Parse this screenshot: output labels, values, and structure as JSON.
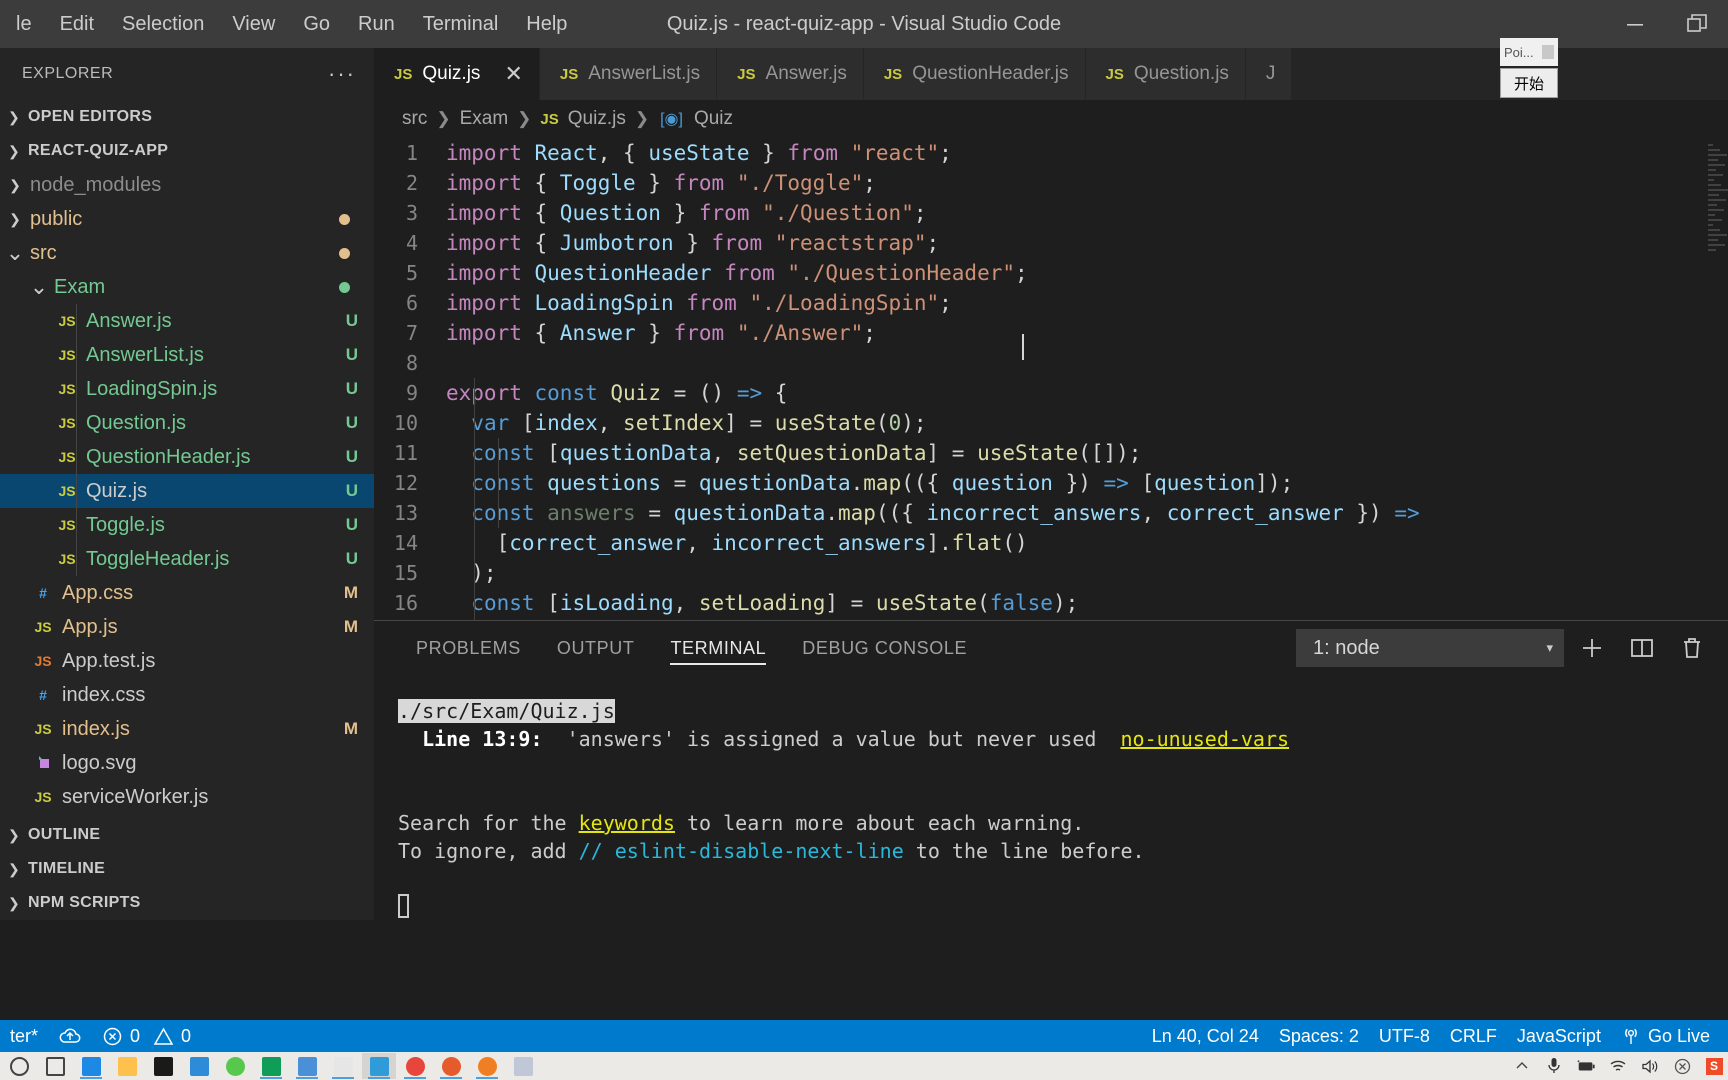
{
  "titlebar": {
    "menu": [
      "le",
      "Edit",
      "Selection",
      "View",
      "Go",
      "Run",
      "Terminal",
      "Help"
    ],
    "window_title": "Quiz.js - react-quiz-app - Visual Studio Code",
    "minimize_label": "minimize",
    "restore_label": "restore"
  },
  "popup": {
    "top_label": "Poi...",
    "bottom_label": "开始"
  },
  "sidebar": {
    "title": "EXPLORER",
    "more_actions": "···",
    "sections": [
      {
        "label": "OPEN EDITORS",
        "expanded": false
      },
      {
        "label": "REACT-QUIZ-APP",
        "expanded": true
      }
    ],
    "tree": [
      {
        "name": "node_modules",
        "type": "folder",
        "expanded": false,
        "indent": 1,
        "color": "dim",
        "git": "",
        "dot": ""
      },
      {
        "name": "public",
        "type": "folder",
        "expanded": false,
        "indent": 1,
        "color": "modified",
        "git": "",
        "dot": "#e2c08d"
      },
      {
        "name": "src",
        "type": "folder",
        "expanded": true,
        "indent": 1,
        "color": "modified",
        "git": "",
        "dot": "#e2c08d"
      },
      {
        "name": "Exam",
        "type": "folder",
        "expanded": true,
        "indent": 2,
        "color": "untracked",
        "git": "",
        "dot": "#73c991"
      },
      {
        "name": "Answer.js",
        "type": "js",
        "indent": 3,
        "color": "untracked",
        "git": "U"
      },
      {
        "name": "AnswerList.js",
        "type": "js",
        "indent": 3,
        "color": "untracked",
        "git": "U"
      },
      {
        "name": "LoadingSpin.js",
        "type": "js",
        "indent": 3,
        "color": "untracked",
        "git": "U"
      },
      {
        "name": "Question.js",
        "type": "js",
        "indent": 3,
        "color": "untracked",
        "git": "U"
      },
      {
        "name": "QuestionHeader.js",
        "type": "js",
        "indent": 3,
        "color": "untracked",
        "git": "U"
      },
      {
        "name": "Quiz.js",
        "type": "js",
        "indent": 3,
        "color": "plain",
        "git": "U",
        "selected": true
      },
      {
        "name": "Toggle.js",
        "type": "js",
        "indent": 3,
        "color": "untracked",
        "git": "U"
      },
      {
        "name": "ToggleHeader.js",
        "type": "js",
        "indent": 3,
        "color": "untracked",
        "git": "U"
      },
      {
        "name": "App.css",
        "type": "css",
        "indent": 2,
        "color": "modified",
        "git": "M"
      },
      {
        "name": "App.js",
        "type": "js",
        "indent": 2,
        "color": "modified",
        "git": "M"
      },
      {
        "name": "App.test.js",
        "type": "jstest",
        "indent": 2,
        "color": "plain",
        "git": ""
      },
      {
        "name": "index.css",
        "type": "css",
        "indent": 2,
        "color": "plain",
        "git": ""
      },
      {
        "name": "index.js",
        "type": "js",
        "indent": 2,
        "color": "modified",
        "git": "M"
      },
      {
        "name": "logo.svg",
        "type": "svg",
        "indent": 2,
        "color": "plain",
        "git": ""
      },
      {
        "name": "serviceWorker.js",
        "type": "js",
        "indent": 2,
        "color": "plain",
        "git": ""
      }
    ],
    "bottom_sections": [
      {
        "label": "OUTLINE"
      },
      {
        "label": "TIMELINE"
      },
      {
        "label": "NPM SCRIPTS"
      }
    ]
  },
  "editor": {
    "tabs": [
      {
        "label": "Quiz.js",
        "icon": "JS",
        "active": true,
        "closable": true
      },
      {
        "label": "AnswerList.js",
        "icon": "JS",
        "active": false
      },
      {
        "label": "Answer.js",
        "icon": "JS",
        "active": false
      },
      {
        "label": "QuestionHeader.js",
        "icon": "JS",
        "active": false
      },
      {
        "label": "Question.js",
        "icon": "JS",
        "active": false
      },
      {
        "label": "J",
        "icon": "",
        "active": false
      }
    ],
    "breadcrumb": [
      "src",
      "Exam",
      "Quiz.js",
      "Quiz"
    ],
    "breadcrumb_file_icon": "JS",
    "breadcrumb_symbol_icon": "symbol-class-icon",
    "code_lines": [
      {
        "n": 1,
        "tokens": [
          [
            "kw",
            "import"
          ],
          [
            "p",
            " "
          ],
          [
            "id",
            "React"
          ],
          [
            "p",
            ", { "
          ],
          [
            "id",
            "useState"
          ],
          [
            "p",
            " } "
          ],
          [
            "kw",
            "from"
          ],
          [
            "p",
            " "
          ],
          [
            "str",
            "\"react\""
          ],
          [
            "p",
            ";"
          ]
        ]
      },
      {
        "n": 2,
        "tokens": [
          [
            "kw",
            "import"
          ],
          [
            "p",
            " { "
          ],
          [
            "id",
            "Toggle"
          ],
          [
            "p",
            " } "
          ],
          [
            "kw",
            "from"
          ],
          [
            "p",
            " "
          ],
          [
            "str",
            "\"./Toggle\""
          ],
          [
            "p",
            ";"
          ]
        ]
      },
      {
        "n": 3,
        "tokens": [
          [
            "kw",
            "import"
          ],
          [
            "p",
            " { "
          ],
          [
            "id",
            "Question"
          ],
          [
            "p",
            " } "
          ],
          [
            "kw",
            "from"
          ],
          [
            "p",
            " "
          ],
          [
            "str",
            "\"./Question\""
          ],
          [
            "p",
            ";"
          ]
        ]
      },
      {
        "n": 4,
        "tokens": [
          [
            "kw",
            "import"
          ],
          [
            "p",
            " { "
          ],
          [
            "id",
            "Jumbotron"
          ],
          [
            "p",
            " } "
          ],
          [
            "kw",
            "from"
          ],
          [
            "p",
            " "
          ],
          [
            "str",
            "\"reactstrap\""
          ],
          [
            "p",
            ";"
          ]
        ]
      },
      {
        "n": 5,
        "tokens": [
          [
            "kw",
            "import"
          ],
          [
            "p",
            " "
          ],
          [
            "id",
            "QuestionHeader"
          ],
          [
            "p",
            " "
          ],
          [
            "kw",
            "from"
          ],
          [
            "p",
            " "
          ],
          [
            "str",
            "\"./QuestionHeader\""
          ],
          [
            "p",
            ";"
          ]
        ]
      },
      {
        "n": 6,
        "tokens": [
          [
            "kw",
            "import"
          ],
          [
            "p",
            " "
          ],
          [
            "id",
            "LoadingSpin"
          ],
          [
            "p",
            " "
          ],
          [
            "kw",
            "from"
          ],
          [
            "p",
            " "
          ],
          [
            "str",
            "\"./LoadingSpin\""
          ],
          [
            "p",
            ";"
          ]
        ]
      },
      {
        "n": 7,
        "tokens": [
          [
            "kw",
            "import"
          ],
          [
            "p",
            " { "
          ],
          [
            "id",
            "Answer"
          ],
          [
            "p",
            " } "
          ],
          [
            "kw",
            "from"
          ],
          [
            "p",
            " "
          ],
          [
            "str",
            "\"./Answer\""
          ],
          [
            "p",
            ";"
          ]
        ]
      },
      {
        "n": 8,
        "tokens": []
      },
      {
        "n": 9,
        "tokens": [
          [
            "kw",
            "export"
          ],
          [
            "p",
            " "
          ],
          [
            "decl",
            "const"
          ],
          [
            "p",
            " "
          ],
          [
            "fn",
            "Quiz"
          ],
          [
            "p",
            " = () "
          ],
          [
            "arrow",
            "=>"
          ],
          [
            "p",
            " {"
          ]
        ]
      },
      {
        "n": 10,
        "tokens": [
          [
            "p",
            "  "
          ],
          [
            "decl",
            "var"
          ],
          [
            "p",
            " ["
          ],
          [
            "id",
            "index"
          ],
          [
            "p",
            ", "
          ],
          [
            "fn",
            "setIndex"
          ],
          [
            "p",
            "] = "
          ],
          [
            "fn",
            "useState"
          ],
          [
            "p",
            "("
          ],
          [
            "num",
            "0"
          ],
          [
            "p",
            ");"
          ]
        ]
      },
      {
        "n": 11,
        "tokens": [
          [
            "p",
            "  "
          ],
          [
            "decl",
            "const"
          ],
          [
            "p",
            " ["
          ],
          [
            "id",
            "questionData"
          ],
          [
            "p",
            ", "
          ],
          [
            "fn",
            "setQuestionData"
          ],
          [
            "p",
            "] = "
          ],
          [
            "fn",
            "useState"
          ],
          [
            "p",
            "([]);"
          ]
        ]
      },
      {
        "n": 12,
        "tokens": [
          [
            "p",
            "  "
          ],
          [
            "decl",
            "const"
          ],
          [
            "p",
            " "
          ],
          [
            "id",
            "questions"
          ],
          [
            "p",
            " = "
          ],
          [
            "id",
            "questionData"
          ],
          [
            "p",
            "."
          ],
          [
            "fn",
            "map"
          ],
          [
            "p",
            "(({ "
          ],
          [
            "id",
            "question"
          ],
          [
            "p",
            " }) "
          ],
          [
            "arrow",
            "=>"
          ],
          [
            "p",
            " ["
          ],
          [
            "id",
            "question"
          ],
          [
            "p",
            "]);"
          ]
        ]
      },
      {
        "n": 13,
        "tokens": [
          [
            "p",
            "  "
          ],
          [
            "decl",
            "const"
          ],
          [
            "p",
            " "
          ],
          [
            "unused",
            "answers"
          ],
          [
            "p",
            " = "
          ],
          [
            "id",
            "questionData"
          ],
          [
            "p",
            "."
          ],
          [
            "fn",
            "map"
          ],
          [
            "p",
            "(({ "
          ],
          [
            "id",
            "incorrect_answers"
          ],
          [
            "p",
            ", "
          ],
          [
            "id",
            "correct_answer"
          ],
          [
            "p",
            " }) "
          ],
          [
            "arrow",
            "=>"
          ]
        ]
      },
      {
        "n": 14,
        "tokens": [
          [
            "p",
            "    ["
          ],
          [
            "id",
            "correct_answer"
          ],
          [
            "p",
            ", "
          ],
          [
            "id",
            "incorrect_answers"
          ],
          [
            "p",
            "]."
          ],
          [
            "fn",
            "flat"
          ],
          [
            "p",
            "()"
          ]
        ]
      },
      {
        "n": 15,
        "tokens": [
          [
            "p",
            "  );"
          ]
        ]
      },
      {
        "n": 16,
        "tokens": [
          [
            "p",
            "  "
          ],
          [
            "decl",
            "const"
          ],
          [
            "p",
            " ["
          ],
          [
            "id",
            "isLoading"
          ],
          [
            "p",
            ", "
          ],
          [
            "fn",
            "setLoading"
          ],
          [
            "p",
            "] = "
          ],
          [
            "fn",
            "useState"
          ],
          [
            "p",
            "("
          ],
          [
            "blue",
            "false"
          ],
          [
            "p",
            ");"
          ]
        ]
      }
    ]
  },
  "panel": {
    "tabs": [
      "PROBLEMS",
      "OUTPUT",
      "TERMINAL",
      "DEBUG CONSOLE"
    ],
    "active_tab": "TERMINAL",
    "terminal_select": "1: node",
    "actions": [
      "new-terminal-icon",
      "split-terminal-icon",
      "kill-terminal-icon"
    ],
    "terminal_lines": [
      {
        "segments": [
          {
            "t": "./src/Exam/Quiz.js",
            "style": "inverted"
          }
        ]
      },
      {
        "segments": [
          {
            "t": "  ",
            "style": "plain"
          },
          {
            "t": "Line 13:9:",
            "style": "bold"
          },
          {
            "t": "  'answers' is assigned a value but never used  ",
            "style": "plain"
          },
          {
            "t": "no-unused-vars",
            "style": "yellow"
          }
        ]
      },
      {
        "segments": []
      },
      {
        "segments": []
      },
      {
        "segments": [
          {
            "t": "Search for the ",
            "style": "plain"
          },
          {
            "t": "keywords",
            "style": "yellow"
          },
          {
            "t": " to learn more about each warning.",
            "style": "plain"
          }
        ]
      },
      {
        "segments": [
          {
            "t": "To ignore, add ",
            "style": "plain"
          },
          {
            "t": "// eslint-disable-next-line",
            "style": "cyan"
          },
          {
            "t": " to the line before.",
            "style": "plain"
          }
        ]
      },
      {
        "segments": []
      }
    ]
  },
  "statusbar": {
    "branch": "ter*",
    "sync_icon": "cloud-upload-icon",
    "errors": "0",
    "warnings": "0",
    "error_icon": "error-circle-icon",
    "warning_icon": "warning-triangle-icon",
    "position": "Ln 40, Col 24",
    "indentation": "Spaces: 2",
    "encoding": "UTF-8",
    "eol": "CRLF",
    "language": "JavaScript",
    "go_live": "Go Live",
    "go_live_icon": "broadcast-icon",
    "accent_color": "#007acc"
  },
  "taskbar": {
    "icons": [
      "cortana-icon",
      "task-view-icon",
      "edge-icon",
      "file-explorer-icon",
      "store-icon",
      "mail-icon",
      "internet-explorer-icon",
      "pycharm-icon",
      "editor-icon",
      "photos-icon",
      "vscode-icon",
      "chrome-icon",
      "firefox-icon",
      "mysql-icon",
      "snipaste-icon"
    ],
    "tray": [
      "show-hidden-icons",
      "microphone-icon",
      "battery-icon",
      "wifi-icon",
      "volume-icon",
      "action-center-icon",
      "snipaste-tray-icon"
    ]
  }
}
